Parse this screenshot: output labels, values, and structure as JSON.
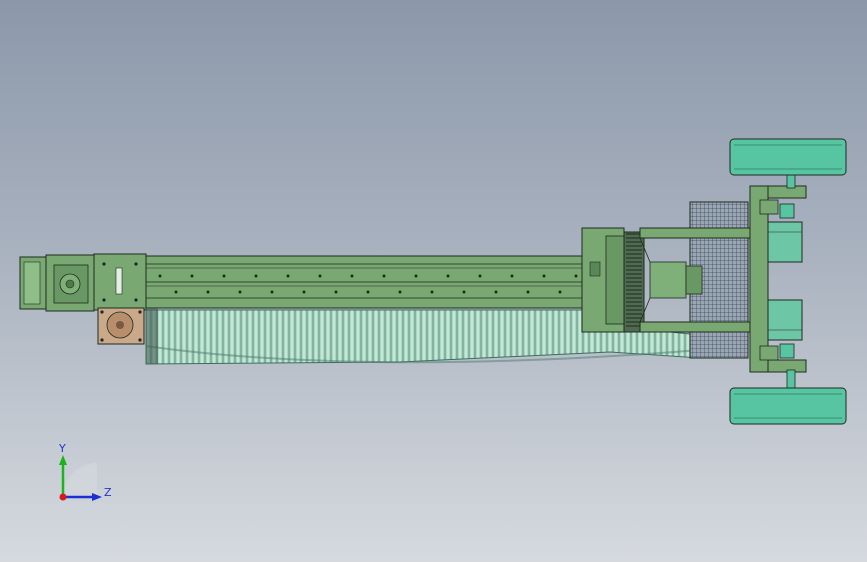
{
  "viewport": {
    "background_top": "#8c98aa",
    "background_bottom": "#d6dadf"
  },
  "model": {
    "frame_color": "#79a873",
    "frame_dark": "#4f7a4c",
    "outline_color": "#1e2a1e",
    "motor_color": "#6dc6a6",
    "wheel_color": "#58c5a2",
    "bellows_color": "#a8d8c4",
    "gearbox_color": "#c9a98a"
  },
  "triad": {
    "y_label": "Y",
    "z_label": "Z",
    "y_color": "#1db31d",
    "z_color": "#1a2fd6",
    "x_color": "#d41a1a"
  }
}
